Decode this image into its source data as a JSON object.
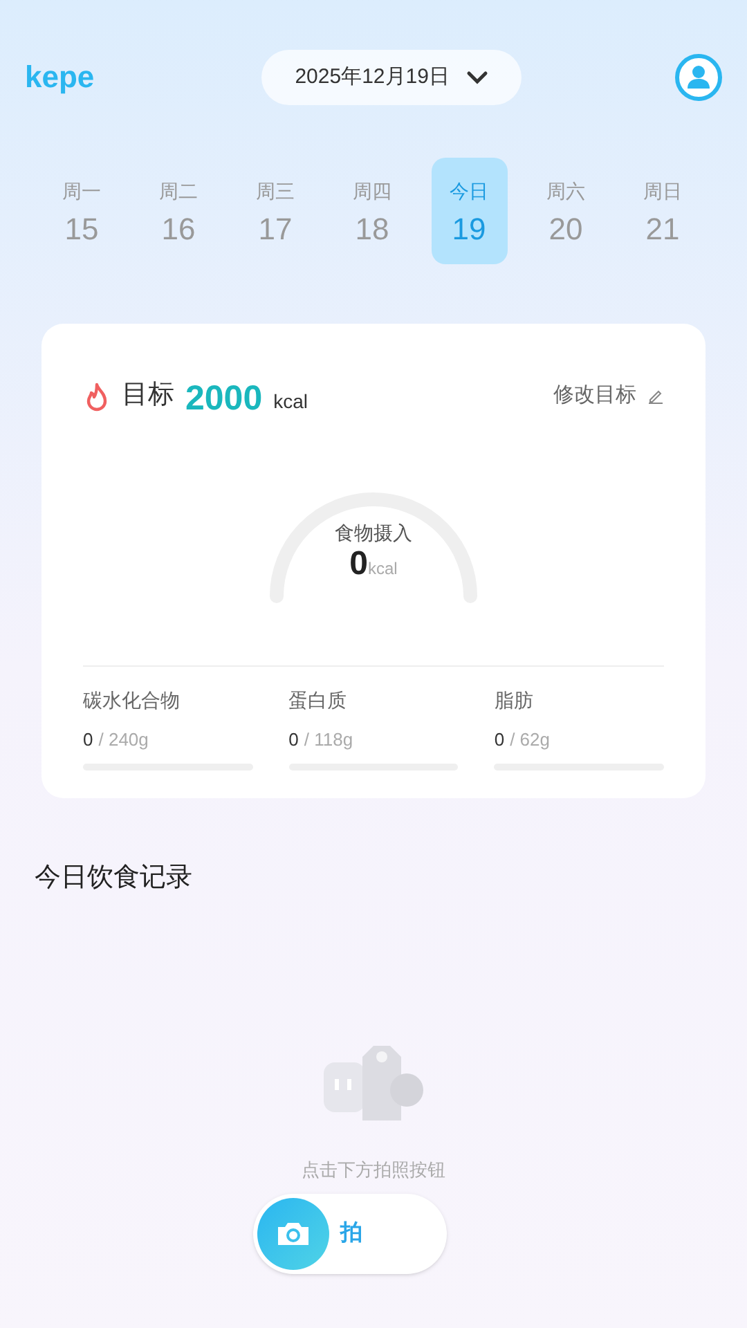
{
  "header": {
    "logo": "kepe",
    "date": "2025年12月19日"
  },
  "week": [
    {
      "weekday": "周一",
      "day": "15",
      "selected": false
    },
    {
      "weekday": "周二",
      "day": "16",
      "selected": false
    },
    {
      "weekday": "周三",
      "day": "17",
      "selected": false
    },
    {
      "weekday": "周四",
      "day": "18",
      "selected": false
    },
    {
      "weekday": "今日",
      "day": "19",
      "selected": true
    },
    {
      "weekday": "周六",
      "day": "20",
      "selected": false
    },
    {
      "weekday": "周日",
      "day": "21",
      "selected": false
    }
  ],
  "goal": {
    "label": "目标",
    "value": "2000",
    "unit": "kcal",
    "edit": "修改目标"
  },
  "intake": {
    "label": "食物摄入",
    "value": "0",
    "unit": "kcal"
  },
  "macros": [
    {
      "name": "碳水化合物",
      "value": "0",
      "target": "/ 240g",
      "level": 0
    },
    {
      "name": "蛋白质",
      "value": "0",
      "target": "/ 118g",
      "level": 0
    },
    {
      "name": "脂肪",
      "value": "0",
      "target": "/ 62g",
      "level": 0
    }
  ],
  "log": {
    "title": "今日饮食记录",
    "hint": "点击下方拍照按钮",
    "camera_button": "拍"
  }
}
